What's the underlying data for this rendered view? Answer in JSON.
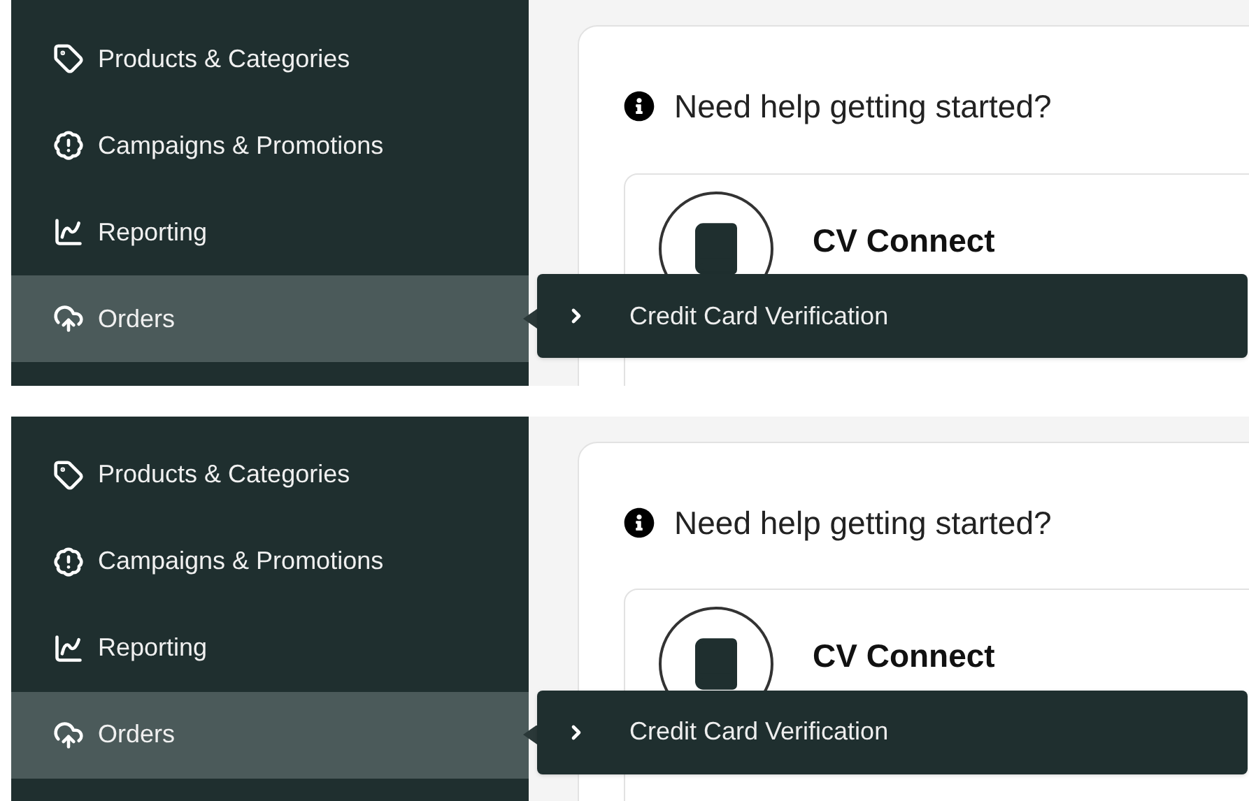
{
  "panels": [
    {
      "sidebar": {
        "items": [
          {
            "label": "Products & Categories",
            "selected": false
          },
          {
            "label": "Campaigns & Promotions",
            "selected": false
          },
          {
            "label": "Reporting",
            "selected": false
          },
          {
            "label": "Orders",
            "selected": true
          }
        ]
      },
      "help": {
        "title": "Need help getting started?",
        "card": {
          "title": "CV Connect"
        }
      },
      "flyout": {
        "items": [
          {
            "label": "Credit Card Verification"
          }
        ]
      }
    },
    {
      "sidebar": {
        "items": [
          {
            "label": "Products & Categories",
            "selected": false
          },
          {
            "label": "Campaigns & Promotions",
            "selected": false
          },
          {
            "label": "Reporting",
            "selected": false
          },
          {
            "label": "Orders",
            "selected": true
          }
        ]
      },
      "help": {
        "title": "Need help getting started?",
        "card": {
          "title": "CV Connect"
        }
      },
      "flyout": {
        "items": [
          {
            "label": "Credit Card Verification"
          }
        ]
      }
    }
  ]
}
